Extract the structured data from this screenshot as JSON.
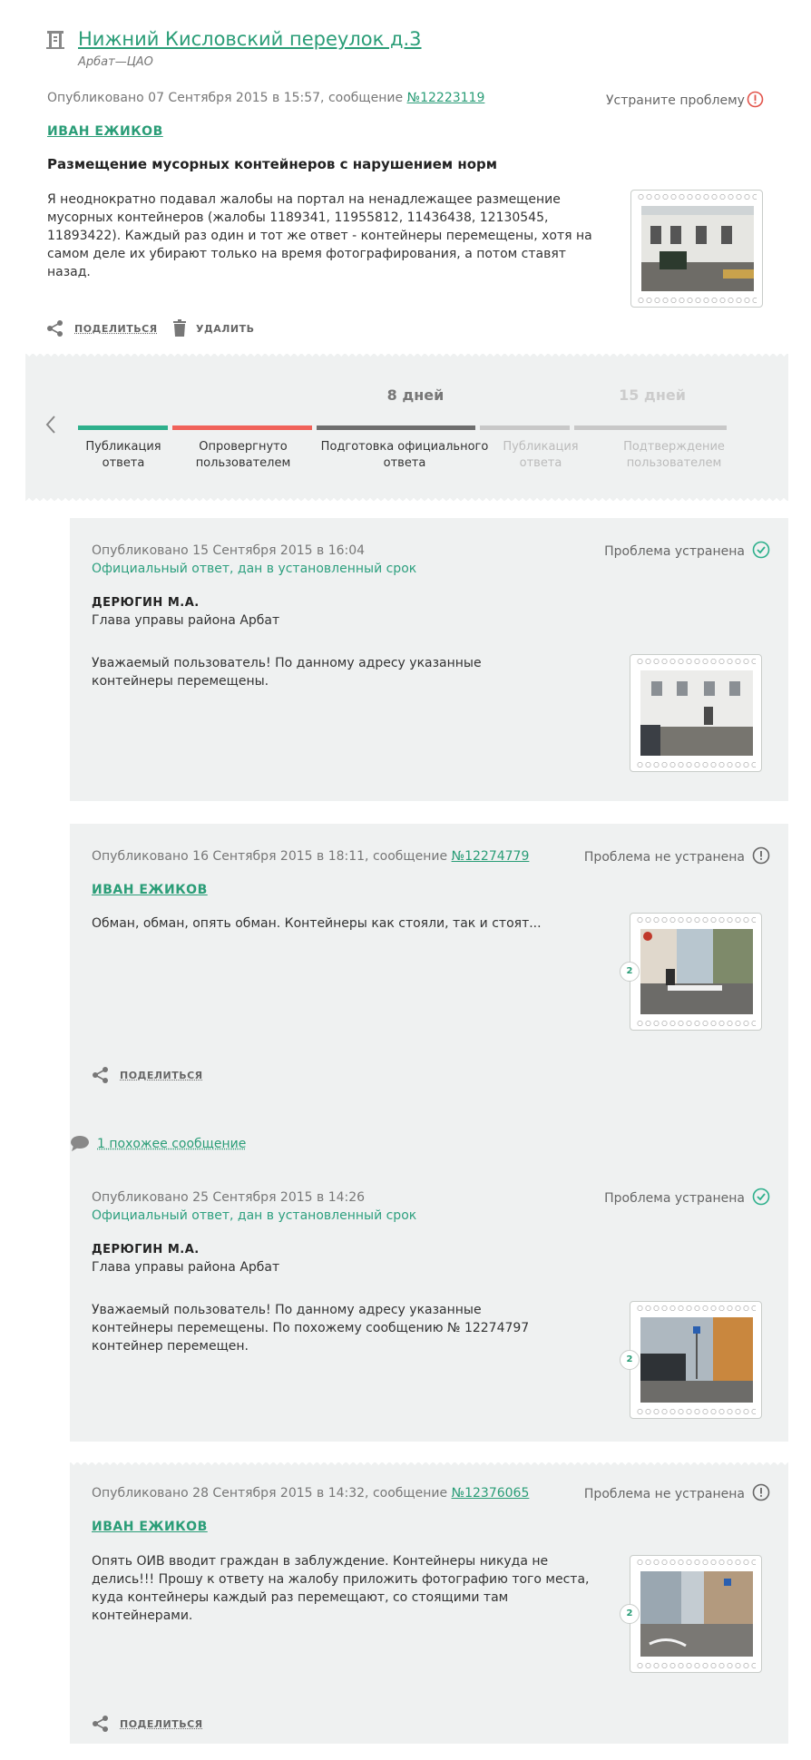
{
  "header": {
    "title": "Нижний Кисловский переулок д.3",
    "district": "Арбат—ЦАО",
    "published": "Опубликовано 07 Сентября 2015 в 15:57, сообщение",
    "message_number": "№12223119",
    "fix_label": "Устраните проблему",
    "author": "ИВАН ЕЖИКОВ",
    "subject": "Размещение мусорных контейнеров с нарушением норм",
    "text": "Я неоднократно подавал жалобы на портал на ненадлежащее размещение мусорных контейнеров (жалобы 1189341, 11955812, 11436438, 12130545, 11893422). Каждый раз один и тот же ответ - контейнеры перемещены, хотя на самом деле их убирают только на время фотографирования, а потом ставят назад.",
    "share_label": "поделиться",
    "delete_label": "удалить"
  },
  "timeline": {
    "day_label_active": "8 дней",
    "day_label_inactive": "15 дней",
    "stages": [
      {
        "label_line1": "Публикация",
        "label_line2": "ответа",
        "color": "#2eb08c",
        "active": true
      },
      {
        "label_line1": "Опровергнуто",
        "label_line2": "пользователем",
        "color": "#f0625a",
        "active": true
      },
      {
        "label_line1": "Подготовка официального",
        "label_line2": "ответа",
        "color": "#6e6e6e",
        "active": true
      },
      {
        "label_line1": "Публикация",
        "label_line2": "ответа",
        "color": "#c8c8c8",
        "active": false
      },
      {
        "label_line1": "Подтверждение",
        "label_line2": "пользователем",
        "color": "#c8c8c8",
        "active": false
      }
    ]
  },
  "entries": [
    {
      "published": "Опубликовано 15 Сентября 2015 в 16:04",
      "official_note": "Официальный ответ, дан в установленный срок",
      "status": "Проблема устранена",
      "author_name": "ДЕРЮГИН М.А.",
      "author_role": "Глава управы района Арбат",
      "text": "Уважаемый пользователь! По данному адресу указанные контейнеры перемещены."
    },
    {
      "published": "Опубликовано 16 Сентября 2015 в 18:11, сообщение",
      "message_number": "№12274779",
      "status": "Проблема не устранена",
      "author": "ИВАН ЕЖИКОВ",
      "text": "Обман, обман, опять обман. Контейнеры как стояли, так и стоят...",
      "photo_count": "2",
      "share_label": "поделиться"
    },
    {
      "published": "Опубликовано 25 Сентября 2015 в 14:26",
      "official_note": "Официальный ответ, дан в установленный срок",
      "status": "Проблема устранена",
      "author_name": "ДЕРЮГИН М.А.",
      "author_role": "Глава управы района Арбат",
      "text": "Уважаемый пользователь! По данному адресу указанные контейнеры перемещены. По похожему сообщению № 12274797 контейнер перемещен.",
      "photo_count": "2"
    },
    {
      "published": "Опубликовано 28 Сентября 2015 в 14:32, сообщение",
      "message_number": "№12376065",
      "status": "Проблема не устранена",
      "author": "ИВАН ЕЖИКОВ",
      "text": "Опять ОИВ вводит граждан в заблуждение. Контейнеры никуда не делись!!! Прошу к ответу на жалобу приложить фотографию того места, куда контейнеры каждый раз перемещают, со стоящими там контейнерами.",
      "photo_count": "2",
      "share_label": "поделиться"
    }
  ],
  "similar": {
    "label": "1 похожее сообщение"
  },
  "colors": {
    "accent": "#2a9d77",
    "alert": "#e2534a",
    "card_bg": "#eff1f1"
  }
}
